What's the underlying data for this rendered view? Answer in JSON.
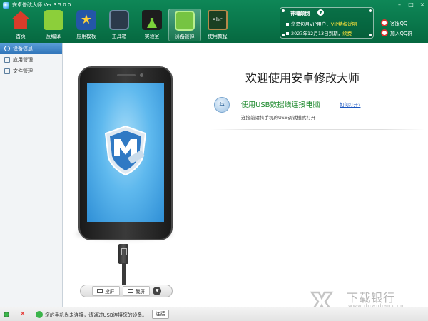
{
  "window": {
    "title": "安卓修改大师 Ver 3.5.0.0",
    "controls": [
      "–",
      "□",
      "×"
    ]
  },
  "toolbar": {
    "items": [
      {
        "label": "首页",
        "icon": "home-icon",
        "active": false
      },
      {
        "label": "反编译",
        "icon": "android-icon",
        "active": false
      },
      {
        "label": "应用模板",
        "icon": "star-template-icon",
        "active": false
      },
      {
        "label": "工具箱",
        "icon": "toolbox-icon",
        "active": false
      },
      {
        "label": "实验室",
        "icon": "flask-icon",
        "active": false
      },
      {
        "label": "设备管理",
        "icon": "device-check-icon",
        "active": true
      },
      {
        "label": "使用教程",
        "icon": "blackboard-icon",
        "active": false
      }
    ]
  },
  "vip": {
    "title": "神魂颠倒",
    "line1_prefix": "您是包月VIP用户，",
    "line1_link": "VIP特权说明",
    "line2_prefix": "2027年12月13日到期，",
    "line2_link": "续费"
  },
  "qq": {
    "service": "客服QQ",
    "group": "加入QQ群"
  },
  "sidebar": {
    "items": [
      {
        "label": "设备信息",
        "active": true
      },
      {
        "label": "应用管理",
        "active": false
      },
      {
        "label": "文件管理",
        "active": false
      }
    ]
  },
  "main": {
    "welcome": "欢迎使用安卓修改大师",
    "usb_title": "使用USB数据线连接电脑",
    "usb_help": "如何打开?",
    "usb_desc": "连接前请将手机的USB调试模式打开"
  },
  "phone_toolbar": {
    "screencast": "投屏",
    "screenshot": "截屏"
  },
  "status": {
    "message": "您的手机尚未连接，请通过USB连接您的设备。",
    "connect_button": "连接"
  },
  "watermark": {
    "title": "下载银行",
    "domain": "www.downbank.cn"
  },
  "colors": {
    "header_green": "#0a7a4d",
    "accent_blue": "#2f73b8",
    "usb_green": "#1e8a2e",
    "link_blue": "#1a56c0",
    "vip_link_yellow": "#ffe43a"
  }
}
